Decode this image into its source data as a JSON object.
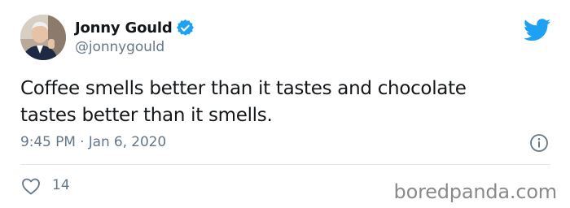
{
  "author": {
    "display_name": "Jonny Gould",
    "handle": "@jonnygould",
    "verified": true,
    "avatar": "profile-photo"
  },
  "tweet": {
    "text_line1": "Coffee smells better than it tastes and chocolate",
    "text_line2": "tastes better than it smells.",
    "timestamp": "9:45 PM · Jan 6, 2020"
  },
  "actions": {
    "likes": "14"
  },
  "icons": {
    "brand": "twitter-bird-icon",
    "verified": "verified-badge-icon",
    "info": "info-icon",
    "like": "heart-icon"
  },
  "colors": {
    "twitter_blue": "#1da1f2",
    "text_primary": "#14171a",
    "text_secondary": "#657786",
    "divider": "#e1e8ed"
  },
  "watermark": "boredpanda.com"
}
